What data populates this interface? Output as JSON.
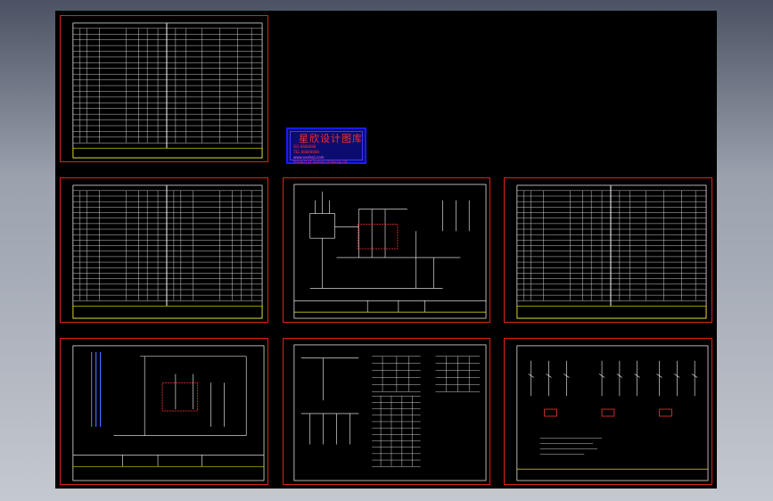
{
  "stamp": {
    "title": "星欣设计图库",
    "line1": "QQ:8888888",
    "line2": "TEL:88888888",
    "line3": "www.xxsheji.com",
    "line4": "Product of xxsheji Drawing Lib"
  },
  "colors": {
    "canvas": "#000000",
    "sheet_border": "#e0201c",
    "frame": "#ffffff",
    "title_block": "#ffff00",
    "highlight": "#ff3333",
    "stamp_bg": "#0c0c6e"
  },
  "sheets": [
    {
      "id": "sheet-1",
      "kind": "parts-list"
    },
    {
      "id": "sheet-2",
      "kind": "parts-list"
    },
    {
      "id": "sheet-3",
      "kind": "schematic"
    },
    {
      "id": "sheet-4",
      "kind": "parts-list"
    },
    {
      "id": "sheet-5",
      "kind": "schematic"
    },
    {
      "id": "sheet-6",
      "kind": "schematic-tables"
    },
    {
      "id": "sheet-7",
      "kind": "schematic-branches"
    }
  ]
}
